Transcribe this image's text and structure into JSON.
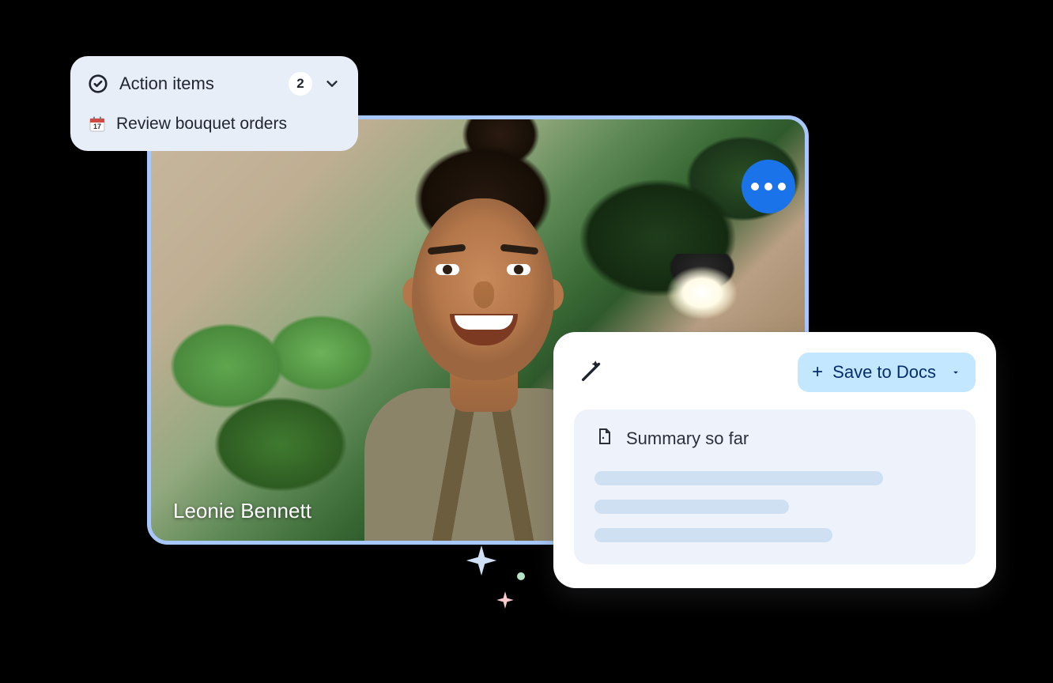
{
  "video": {
    "participant_name": "Leonie Bennett"
  },
  "action_items": {
    "title": "Action items",
    "count": "2",
    "items": [
      {
        "icon_name": "calendar-icon",
        "label": "Review bouquet orders"
      }
    ]
  },
  "summary": {
    "save_button_label": "Save to Docs",
    "body_title": "Summary so far"
  }
}
